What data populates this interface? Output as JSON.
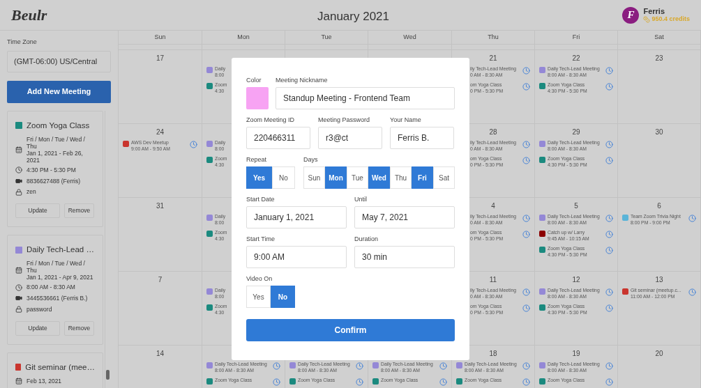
{
  "header": {
    "logo": "Beulr",
    "title": "January 2021",
    "user": {
      "initial": "F",
      "name": "Ferris",
      "credits": "950.4 credits"
    }
  },
  "sidebar": {
    "time_zone_label": "Time Zone",
    "time_zone": "(GMT-06:00) US/Central",
    "add_button": "Add New Meeting",
    "meetings": [
      {
        "title": "Zoom Yoga Class",
        "color": "#1b8a7f",
        "days": "Fri / Mon / Tue / Wed / Thu",
        "dates": "Jan 1, 2021 - Feb 26, 2021",
        "time": "4:30 PM - 5:30 PM",
        "zoom": "8836627488 (Ferris)",
        "password": "zen",
        "buttons": [
          "Update",
          "Remove"
        ]
      },
      {
        "title": "Daily Tech-Lead …",
        "color": "#9488d6",
        "days": "Fri / Mon / Tue / Wed / Thu",
        "dates": "Jan 1, 2021 - Apr 9, 2021",
        "time": "8:00 AM - 8:30 AM",
        "zoom": "3445536661 (Ferris B.)",
        "password": "password",
        "buttons": [
          "Update",
          "Remove"
        ]
      },
      {
        "title": "Git seminar (mee…",
        "color": "#c9352e",
        "dates": "Feb 13, 2021"
      }
    ]
  },
  "calendar": {
    "weekdays": [
      "Sun",
      "Mon",
      "Tue",
      "Wed",
      "Thu",
      "Fri",
      "Sat"
    ],
    "weeks": [
      {
        "before_dialog": [
          {
            "day": "17"
          },
          {
            "events": [
              {
                "kind": "right-cut",
                "title": "Daily",
                "time": "8:00",
                "color": "#9488d6"
              },
              {
                "kind": "right-cut",
                "title": "Zoom",
                "time": "4:30",
                "color": "#1b8a7f"
              }
            ]
          }
        ],
        "after_dialog": [
          {
            "day": "21",
            "events": [
              {
                "kind": "left-cut",
                "title": "ily Tech-Lead Meeting",
                "time": "0 AM - 8:30 AM"
              },
              {
                "kind": "left-cut",
                "title": "om Yoga Class",
                "time": "0 PM - 5:30 PM"
              }
            ]
          },
          {
            "day": "22",
            "events": [
              {
                "kind": "full",
                "title": "Daily Tech-Lead Meeting",
                "time": "8:00 AM - 8:30 AM",
                "color": "#9488d6"
              },
              {
                "kind": "full",
                "title": "Zoom Yoga Class",
                "time": "4:30 PM - 5:30 PM",
                "color": "#1b8a7f"
              }
            ]
          },
          {
            "day": "23"
          }
        ]
      },
      {
        "before_dialog": [
          {
            "day": "24",
            "events": [
              {
                "kind": "full",
                "title": "AWS Dev Meetup",
                "time": "9:00 AM - 9:50 AM",
                "color": "#c9352e"
              }
            ]
          },
          {
            "events": [
              {
                "kind": "right-cut",
                "title": "Daily",
                "time": "8:00",
                "color": "#9488d6"
              },
              {
                "kind": "right-cut",
                "title": "Zoom",
                "time": "4:30",
                "color": "#1b8a7f"
              }
            ]
          }
        ],
        "after_dialog": [
          {
            "day": "28",
            "events": [
              {
                "kind": "left-cut",
                "title": "ily Tech-Lead Meeting",
                "time": "0 AM - 8:30 AM"
              },
              {
                "kind": "left-cut",
                "title": "om Yoga Class",
                "time": "0 PM - 5:30 PM"
              }
            ]
          },
          {
            "day": "29",
            "events": [
              {
                "kind": "full",
                "title": "Daily Tech-Lead Meeting",
                "time": "8:00 AM - 8:30 AM",
                "color": "#9488d6"
              },
              {
                "kind": "full",
                "title": "Zoom Yoga Class",
                "time": "4:30 PM - 5:30 PM",
                "color": "#1b8a7f"
              }
            ]
          },
          {
            "day": "30"
          }
        ]
      },
      {
        "before_dialog": [
          {
            "day": "31"
          },
          {
            "events": [
              {
                "kind": "right-cut",
                "title": "Daily",
                "time": "8:00",
                "color": "#9488d6"
              },
              {
                "kind": "right-cut",
                "title": "Zoom",
                "time": "4:30",
                "color": "#1b8a7f"
              }
            ]
          }
        ],
        "after_dialog": [
          {
            "day": "4",
            "events": [
              {
                "kind": "left-cut",
                "title": "ily Tech-Lead Meeting",
                "time": "0 AM - 8:30 AM"
              },
              {
                "kind": "left-cut",
                "title": "om Yoga Class",
                "time": "0 PM - 5:30 PM"
              }
            ]
          },
          {
            "day": "5",
            "events": [
              {
                "kind": "full",
                "title": "Daily Tech-Lead Meeting",
                "time": "8:00 AM - 8:30 AM",
                "color": "#9488d6"
              },
              {
                "kind": "full",
                "title": "Catch up w/ Larry",
                "time": "9:45 AM - 10:15 AM",
                "color": "#8b0000"
              },
              {
                "kind": "full",
                "title": "Zoom Yoga Class",
                "time": "4:30 PM - 5:30 PM",
                "color": "#1b8a7f"
              }
            ]
          },
          {
            "day": "6",
            "events": [
              {
                "kind": "full",
                "title": "Team Zoom Trivia Night",
                "time": "8:00 PM - 9:00 PM",
                "color": "#5ab4d8"
              }
            ]
          }
        ]
      },
      {
        "before_dialog": [
          {
            "day": "7"
          },
          {
            "events": [
              {
                "kind": "right-cut",
                "title": "Daily",
                "time": "8:00",
                "color": "#9488d6"
              },
              {
                "kind": "right-cut",
                "title": "Zoom",
                "time": "4:30",
                "color": "#1b8a7f"
              }
            ]
          }
        ],
        "after_dialog": [
          {
            "day": "11",
            "events": [
              {
                "kind": "left-cut",
                "title": "ily Tech-Lead Meeting",
                "time": "0 AM - 8:30 AM"
              },
              {
                "kind": "left-cut",
                "title": "om Yoga Class",
                "time": "0 PM - 5:30 PM"
              }
            ]
          },
          {
            "day": "12",
            "events": [
              {
                "kind": "full",
                "title": "Daily Tech-Lead Meeting",
                "time": "8:00 AM - 8:30 AM",
                "color": "#9488d6"
              },
              {
                "kind": "full",
                "title": "Zoom Yoga Class",
                "time": "4:30 PM - 5:30 PM",
                "color": "#1b8a7f"
              }
            ]
          },
          {
            "day": "13",
            "events": [
              {
                "kind": "full",
                "title": "Git seminar (meetup.c...",
                "time": "11:00 AM - 12:00 PM",
                "color": "#c9352e"
              }
            ]
          }
        ]
      },
      {
        "cells": [
          {
            "day": "14"
          },
          {
            "events": [
              {
                "kind": "full",
                "title": "Daily Tech-Lead Meeting",
                "time": "8:00 AM - 8:30 AM",
                "color": "#9488d6"
              },
              {
                "kind": "full",
                "title": "Zoom Yoga Class",
                "color": "#1b8a7f"
              }
            ]
          },
          {
            "events": [
              {
                "kind": "full",
                "title": "Daily Tech-Lead Meeting",
                "time": "8:00 AM - 8:30 AM",
                "color": "#9488d6"
              },
              {
                "kind": "full",
                "title": "Zoom Yoga Class",
                "color": "#1b8a7f"
              }
            ]
          },
          {
            "events": [
              {
                "kind": "full",
                "title": "Daily Tech-Lead Meeting",
                "time": "8:00 AM - 8:30 AM",
                "color": "#9488d6"
              },
              {
                "kind": "full",
                "title": "Zoom Yoga Class",
                "color": "#1b8a7f"
              }
            ]
          },
          {
            "day": "18",
            "events": [
              {
                "kind": "full",
                "title": "Daily Tech-Lead Meeting",
                "time": "8:00 AM - 8:30 AM",
                "color": "#9488d6"
              },
              {
                "kind": "full",
                "title": "Zoom Yoga Class",
                "color": "#1b8a7f"
              }
            ]
          },
          {
            "day": "19",
            "events": [
              {
                "kind": "full",
                "title": "Daily Tech-Lead Meeting",
                "time": "8:00 AM - 8:30 AM",
                "color": "#9488d6"
              },
              {
                "kind": "full",
                "title": "Zoom Yoga Class",
                "color": "#1b8a7f"
              }
            ]
          },
          {
            "day": "20"
          }
        ]
      }
    ]
  },
  "modal": {
    "color_label": "Color",
    "color": "#f7a3f3",
    "nickname_label": "Meeting Nickname",
    "nickname": "Standup Meeting - Frontend Team",
    "fields": [
      {
        "label": "Zoom Meeting ID",
        "value": "220466311"
      },
      {
        "label": "Meeting Password",
        "value": "r3@ct"
      },
      {
        "label": "Your Name",
        "value": "Ferris B."
      }
    ],
    "repeat": {
      "label": "Repeat",
      "options": [
        {
          "label": "Yes",
          "selected": true
        },
        {
          "label": "No",
          "selected": false
        }
      ]
    },
    "days": {
      "label": "Days",
      "options": [
        {
          "label": "Sun",
          "selected": false
        },
        {
          "label": "Mon",
          "selected": true
        },
        {
          "label": "Tue",
          "selected": false
        },
        {
          "label": "Wed",
          "selected": true
        },
        {
          "label": "Thu",
          "selected": false
        },
        {
          "label": "Fri",
          "selected": true
        },
        {
          "label": "Sat",
          "selected": false
        }
      ]
    },
    "dates": [
      {
        "label": "Start Date",
        "value": "January 1, 2021"
      },
      {
        "label": "Until",
        "value": "May 7, 2021"
      }
    ],
    "times": [
      {
        "label": "Start Time",
        "value": "9:00 AM"
      },
      {
        "label": "Duration",
        "value": "30 min"
      }
    ],
    "video": {
      "label": "Video On",
      "options": [
        {
          "label": "Yes",
          "selected": false
        },
        {
          "label": "No",
          "selected": true
        }
      ]
    },
    "confirm": "Confirm"
  }
}
